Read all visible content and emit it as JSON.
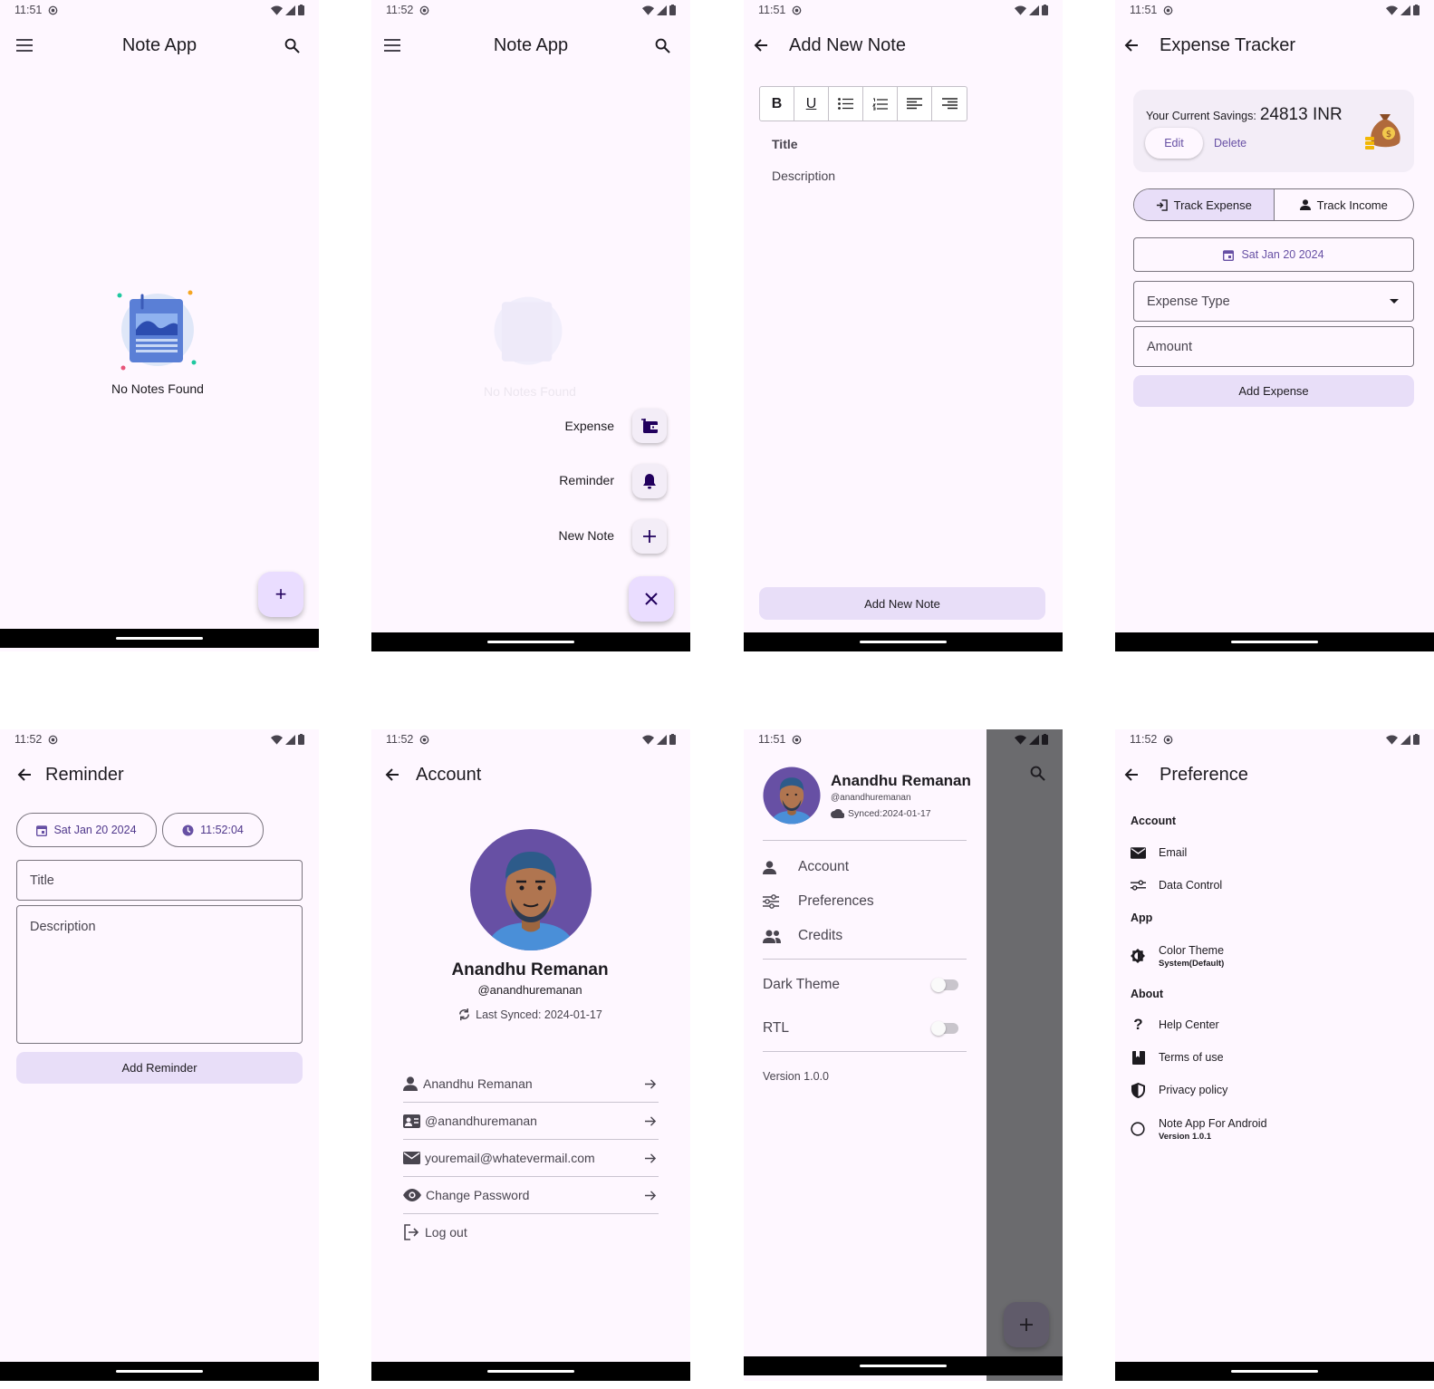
{
  "screens": {
    "home_empty": {
      "time": "11:51",
      "title": "Note App",
      "empty_text": "No Notes Found",
      "fab_label": "+"
    },
    "home_fab_menu": {
      "time": "11:52",
      "title": "Note App",
      "empty_text": "No Notes Found",
      "menu": [
        "Expense",
        "Reminder",
        "New Note"
      ]
    },
    "add_note": {
      "time": "11:51",
      "title": "Add New Note",
      "title_placeholder": "Title",
      "description_placeholder": "Description",
      "submit": "Add New Note",
      "toolbar": [
        "bold-icon",
        "underline-icon",
        "bullet-list-icon",
        "numbered-list-icon",
        "align-left-icon",
        "align-right-icon"
      ]
    },
    "expense": {
      "time": "11:51",
      "title": "Expense Tracker",
      "savings_label": "Your Current Savings:",
      "savings_value": "24813 INR",
      "edit": "Edit",
      "delete": "Delete",
      "tab_expense": "Track Expense",
      "tab_income": "Track Income",
      "date": "Sat Jan 20 2024",
      "expense_type_placeholder": "Expense Type",
      "amount_placeholder": "Amount",
      "submit": "Add Expense"
    },
    "reminder": {
      "time": "11:52",
      "title": "Reminder",
      "date": "Sat Jan 20 2024",
      "clock": "11:52:04",
      "title_placeholder": "Title",
      "description_placeholder": "Description",
      "submit": "Add Reminder"
    },
    "account": {
      "time": "11:52",
      "title": "Account",
      "name": "Anandhu Remanan",
      "handle": "@anandhuremanan",
      "synced": "Last Synced: 2024-01-17",
      "items": [
        {
          "label": "Anandhu Remanan",
          "icon": "person-icon"
        },
        {
          "label": "@anandhuremanan",
          "icon": "id-card-icon"
        },
        {
          "label": "youremail@whatevermail.com",
          "icon": "mail-icon"
        },
        {
          "label": "Change Password",
          "icon": "eye-icon"
        },
        {
          "label": "Log out",
          "icon": "logout-icon"
        }
      ]
    },
    "drawer": {
      "time": "11:51",
      "name": "Anandhu Remanan",
      "handle": "@anandhuremanan",
      "synced": "Synced:2024-01-17",
      "items": [
        "Account",
        "Preferences",
        "Credits"
      ],
      "dark_theme": "Dark Theme",
      "rtl": "RTL",
      "version": "Version 1.0.0"
    },
    "preference": {
      "time": "11:52",
      "title": "Preference",
      "section_account": "Account",
      "email": "Email",
      "data_control": "Data Control",
      "section_app": "App",
      "color_theme": "Color Theme",
      "color_theme_sub": "System(Default)",
      "section_about": "About",
      "help": "Help Center",
      "terms": "Terms of use",
      "privacy": "Privacy policy",
      "about_app": "Note App For Android",
      "about_version": "Version 1.0.1"
    }
  },
  "colors": {
    "surface": "#fef7ff",
    "primary": "#6750a4",
    "tonal": "#e8def8",
    "scrim": "#6b6b6e"
  }
}
